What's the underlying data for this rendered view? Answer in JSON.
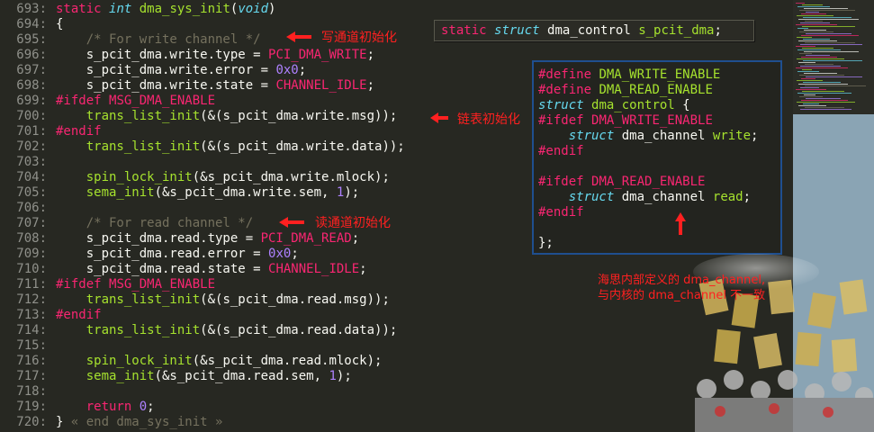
{
  "editor": {
    "lines": [
      {
        "num": "693:",
        "code": [
          [
            "kw",
            "static "
          ],
          [
            "ty",
            "int "
          ],
          [
            "fn",
            "dma_sys_init"
          ],
          [
            "pl",
            "("
          ],
          [
            "ty",
            "void"
          ],
          [
            "pl",
            ")"
          ]
        ]
      },
      {
        "num": "694:",
        "code": [
          [
            "pl",
            "{"
          ]
        ]
      },
      {
        "num": "695:",
        "code": [
          [
            "pl",
            "    "
          ],
          [
            "cm",
            "/* For write channel */"
          ]
        ]
      },
      {
        "num": "696:",
        "code": [
          [
            "pl",
            "    s_pcit_dma.write.type = "
          ],
          [
            "ma",
            "PCI_DMA_WRITE"
          ],
          [
            "pl",
            ";"
          ]
        ]
      },
      {
        "num": "697:",
        "code": [
          [
            "pl",
            "    s_pcit_dma.write.error = "
          ],
          [
            "num",
            "0x0"
          ],
          [
            "pl",
            ";"
          ]
        ]
      },
      {
        "num": "698:",
        "code": [
          [
            "pl",
            "    s_pcit_dma.write.state = "
          ],
          [
            "ma",
            "CHANNEL_IDLE"
          ],
          [
            "pl",
            ";"
          ]
        ]
      },
      {
        "num": "699:",
        "code": [
          [
            "pp",
            "#ifdef "
          ],
          [
            "ma",
            "MSG_DMA_ENABLE"
          ]
        ]
      },
      {
        "num": "700:",
        "code": [
          [
            "pl",
            "    "
          ],
          [
            "fn",
            "trans_list_init"
          ],
          [
            "pl",
            "(&(s_pcit_dma.write.msg));"
          ]
        ]
      },
      {
        "num": "701:",
        "code": [
          [
            "pp",
            "#endif"
          ]
        ]
      },
      {
        "num": "702:",
        "code": [
          [
            "pl",
            "    "
          ],
          [
            "fn",
            "trans_list_init"
          ],
          [
            "pl",
            "(&(s_pcit_dma.write.data));"
          ]
        ]
      },
      {
        "num": "703:",
        "code": []
      },
      {
        "num": "704:",
        "code": [
          [
            "pl",
            "    "
          ],
          [
            "fn",
            "spin_lock_init"
          ],
          [
            "pl",
            "(&s_pcit_dma.write.mlock);"
          ]
        ]
      },
      {
        "num": "705:",
        "code": [
          [
            "pl",
            "    "
          ],
          [
            "fn",
            "sema_init"
          ],
          [
            "pl",
            "(&s_pcit_dma.write.sem, "
          ],
          [
            "num",
            "1"
          ],
          [
            "pl",
            ");"
          ]
        ]
      },
      {
        "num": "706:",
        "code": []
      },
      {
        "num": "707:",
        "code": [
          [
            "pl",
            "    "
          ],
          [
            "cm",
            "/* For read channel */"
          ]
        ]
      },
      {
        "num": "708:",
        "code": [
          [
            "pl",
            "    s_pcit_dma.read.type = "
          ],
          [
            "ma",
            "PCI_DMA_READ"
          ],
          [
            "pl",
            ";"
          ]
        ]
      },
      {
        "num": "709:",
        "code": [
          [
            "pl",
            "    s_pcit_dma.read.error = "
          ],
          [
            "num",
            "0x0"
          ],
          [
            "pl",
            ";"
          ]
        ]
      },
      {
        "num": "710:",
        "code": [
          [
            "pl",
            "    s_pcit_dma.read.state = "
          ],
          [
            "ma",
            "CHANNEL_IDLE"
          ],
          [
            "pl",
            ";"
          ]
        ]
      },
      {
        "num": "711:",
        "code": [
          [
            "pp",
            "#ifdef "
          ],
          [
            "ma",
            "MSG_DMA_ENABLE"
          ]
        ]
      },
      {
        "num": "712:",
        "code": [
          [
            "pl",
            "    "
          ],
          [
            "fn",
            "trans_list_init"
          ],
          [
            "pl",
            "(&(s_pcit_dma.read.msg));"
          ]
        ]
      },
      {
        "num": "713:",
        "code": [
          [
            "pp",
            "#endif"
          ]
        ]
      },
      {
        "num": "714:",
        "code": [
          [
            "pl",
            "    "
          ],
          [
            "fn",
            "trans_list_init"
          ],
          [
            "pl",
            "(&(s_pcit_dma.read.data));"
          ]
        ]
      },
      {
        "num": "715:",
        "code": []
      },
      {
        "num": "716:",
        "code": [
          [
            "pl",
            "    "
          ],
          [
            "fn",
            "spin_lock_init"
          ],
          [
            "pl",
            "(&s_pcit_dma.read.mlock);"
          ]
        ]
      },
      {
        "num": "717:",
        "code": [
          [
            "pl",
            "    "
          ],
          [
            "fn",
            "sema_init"
          ],
          [
            "pl",
            "(&s_pcit_dma.read.sem, "
          ],
          [
            "num",
            "1"
          ],
          [
            "pl",
            ");"
          ]
        ]
      },
      {
        "num": "718:",
        "code": []
      },
      {
        "num": "719:",
        "code": [
          [
            "pl",
            "    "
          ],
          [
            "kw",
            "return "
          ],
          [
            "num",
            "0"
          ],
          [
            "pl",
            ";"
          ]
        ]
      },
      {
        "num": "720:",
        "code": [
          [
            "pl",
            "} "
          ],
          [
            "dim",
            "« end dma_sys_init »"
          ]
        ]
      }
    ]
  },
  "annotations": {
    "write_init": "写通道初始化",
    "list_init": "链表初始化",
    "read_init": "读通道初始化",
    "note": "海思内部定义的 dma_channel,\n与内核的 dma_channel 不一致"
  },
  "declaration": {
    "code": [
      [
        "kw",
        "static "
      ],
      [
        "ty",
        "struct "
      ],
      [
        "pl",
        "dma_control "
      ],
      [
        "fn",
        "s_pcit_dma"
      ],
      [
        "pl",
        ";"
      ]
    ]
  },
  "struct_box": {
    "lines": [
      [
        [
          "pp",
          "#define "
        ],
        [
          "fn",
          "DMA_WRITE_ENABLE"
        ]
      ],
      [
        [
          "pp",
          "#define "
        ],
        [
          "fn",
          "DMA_READ_ENABLE"
        ]
      ],
      [
        [
          "ty",
          "struct "
        ],
        [
          "fn",
          "dma_control"
        ],
        [
          "pl",
          " {"
        ]
      ],
      [
        [
          "pp",
          "#ifdef "
        ],
        [
          "ma",
          "DMA_WRITE_ENABLE"
        ]
      ],
      [
        [
          "pl",
          "    "
        ],
        [
          "ty",
          "struct "
        ],
        [
          "pl",
          "dma_channel "
        ],
        [
          "fn",
          "write"
        ],
        [
          "pl",
          ";"
        ]
      ],
      [
        [
          "pp",
          "#endif"
        ]
      ],
      [],
      [
        [
          "pp",
          "#ifdef "
        ],
        [
          "ma",
          "DMA_READ_ENABLE"
        ]
      ],
      [
        [
          "pl",
          "    "
        ],
        [
          "ty",
          "struct "
        ],
        [
          "pl",
          "dma_channel "
        ],
        [
          "fn",
          "read"
        ],
        [
          "pl",
          ";"
        ]
      ],
      [
        [
          "pp",
          "#endif"
        ]
      ],
      [],
      [
        [
          "pl",
          "};"
        ]
      ]
    ]
  },
  "colors": {
    "background": "#272822",
    "annotation": "#ff2020",
    "box_border": "#1f4f8f"
  }
}
